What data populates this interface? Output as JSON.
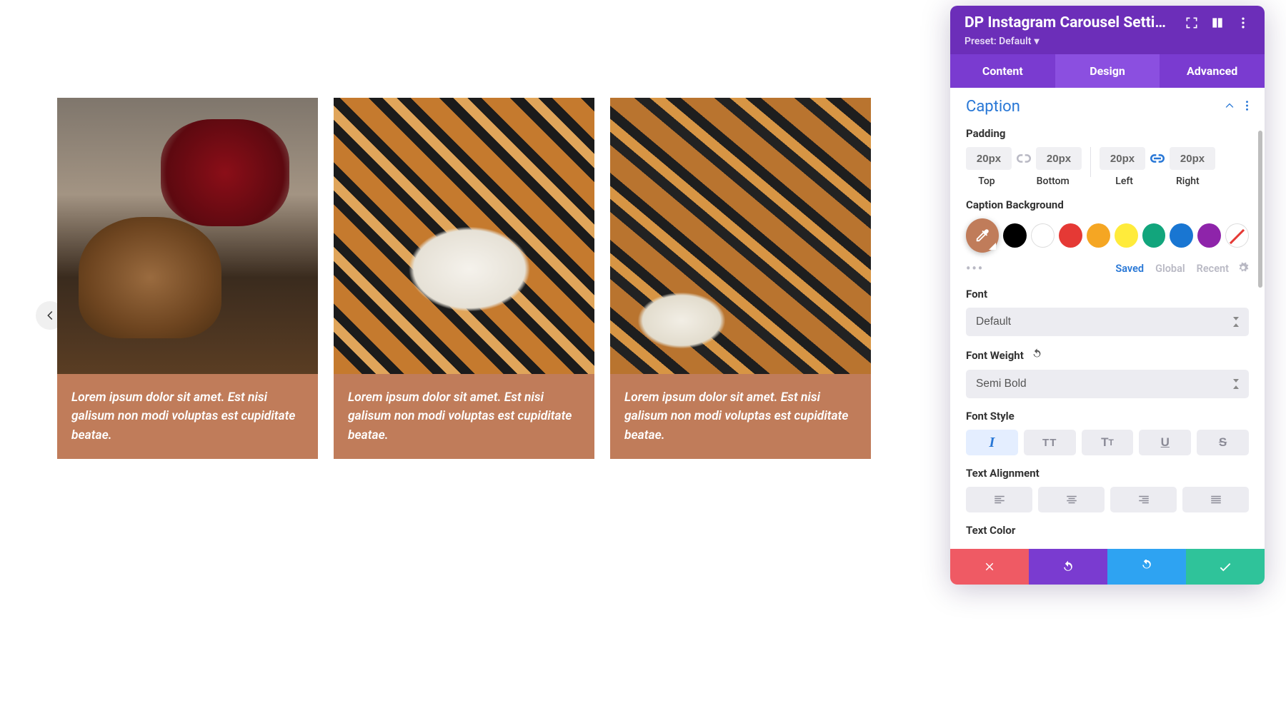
{
  "carousel": {
    "cards": [
      {
        "caption": "Lorem ipsum dolor sit amet. Est nisi galisum non modi voluptas est cupiditate beatae."
      },
      {
        "caption": "Lorem ipsum dolor sit amet. Est nisi galisum non modi voluptas est cupiditate beatae."
      },
      {
        "caption": "Lorem ipsum dolor sit amet. Est nisi galisum non modi voluptas est cupiditate beatae."
      }
    ]
  },
  "panel": {
    "title": "DP Instagram Carousel Setti…",
    "preset_label": "Preset: Default",
    "tabs": {
      "content": "Content",
      "design": "Design",
      "advanced": "Advanced",
      "active": "design"
    },
    "section_title": "Caption",
    "padding": {
      "label": "Padding",
      "top": {
        "value": "20px",
        "sub": "Top"
      },
      "bottom": {
        "value": "20px",
        "sub": "Bottom"
      },
      "left": {
        "value": "20px",
        "sub": "Left"
      },
      "right": {
        "value": "20px",
        "sub": "Right"
      }
    },
    "caption_bg": {
      "label": "Caption Background",
      "swatches": [
        "#000000",
        "#ffffff",
        "#e53935",
        "#f5a623",
        "#ffeb3b",
        "#12a57c",
        "#1976d2",
        "#8e24aa"
      ],
      "meta": {
        "saved": "Saved",
        "global": "Global",
        "recent": "Recent"
      }
    },
    "font": {
      "label": "Font",
      "value": "Default"
    },
    "font_weight": {
      "label": "Font Weight",
      "value": "Semi Bold"
    },
    "font_style": {
      "label": "Font Style"
    },
    "text_align": {
      "label": "Text Alignment"
    },
    "text_color": {
      "label": "Text Color"
    }
  }
}
